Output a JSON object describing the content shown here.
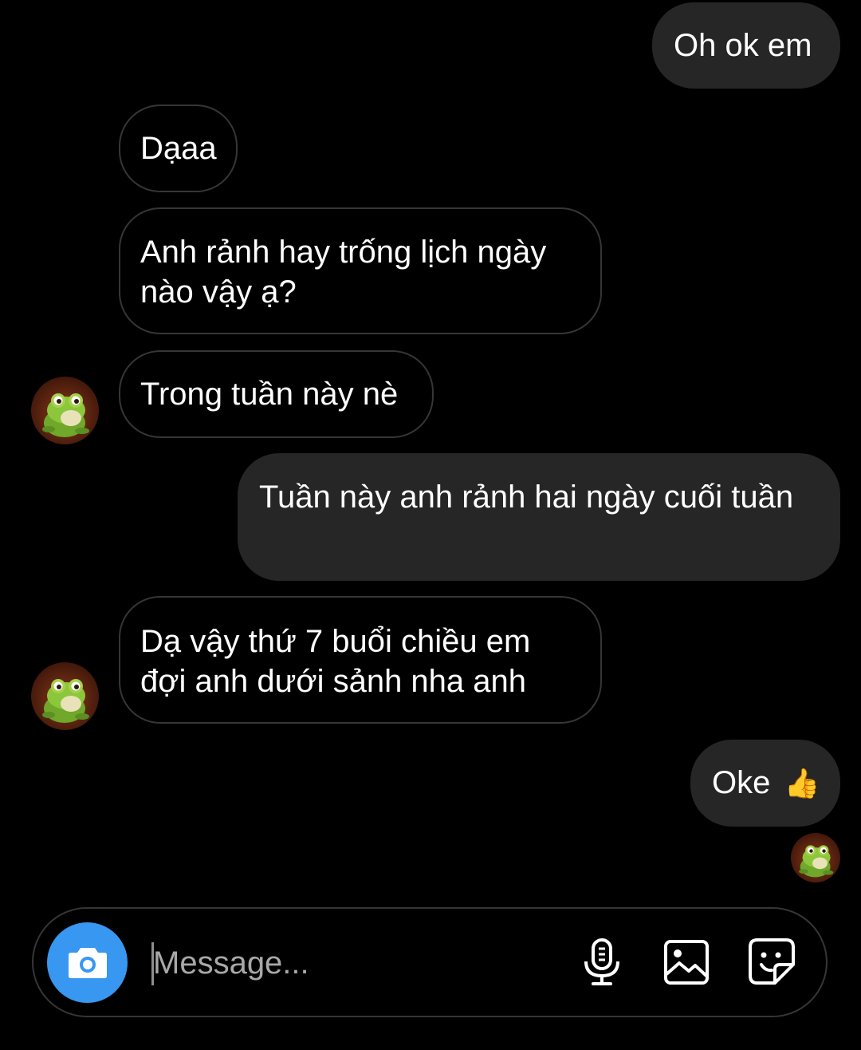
{
  "conversation": {
    "messages": [
      {
        "direction": "sent",
        "text": "Oh ok em"
      },
      {
        "direction": "received",
        "text": "Dạaa"
      },
      {
        "direction": "received",
        "text": "Anh rảnh hay trống lịch ngày nào vậy ạ?"
      },
      {
        "direction": "received",
        "text": "Trong tuần này nè"
      },
      {
        "direction": "sent",
        "text": "Tuần này anh rảnh hai ngày cuối tuần"
      },
      {
        "direction": "received",
        "text": "Dạ vậy thứ 7 buổi chiều em đợi anh dưới sảnh nha anh"
      },
      {
        "direction": "sent",
        "text": "Oke",
        "emoji": "👍"
      }
    ]
  },
  "composer": {
    "placeholder": "Message...",
    "value": "",
    "icons": [
      "camera-icon",
      "microphone-icon",
      "gallery-icon",
      "sticker-icon"
    ]
  },
  "colors": {
    "sent_bubble": "#262626",
    "received_border": "#363636",
    "camera_button": "#3897f0",
    "background": "#000000"
  }
}
